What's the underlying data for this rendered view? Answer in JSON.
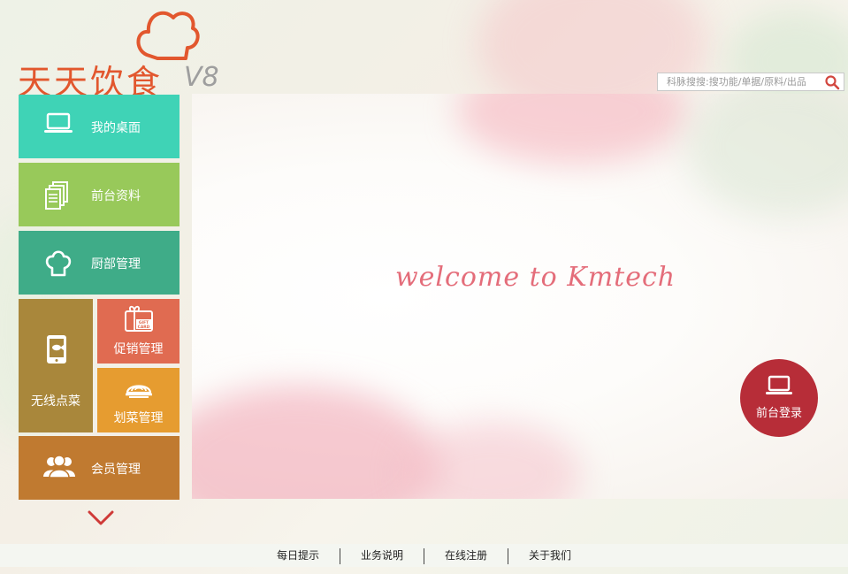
{
  "app": {
    "logo_text": "天天饮食",
    "version": "V8"
  },
  "search": {
    "placeholder": "科脉搜搜:搜功能/单据/原料/出品"
  },
  "main": {
    "welcome": "welcome to Kmtech",
    "login_label": "前台登录"
  },
  "tiles": [
    {
      "label": "我的桌面",
      "icon": "laptop-icon",
      "color": "#3fd3b6"
    },
    {
      "label": "前台资料",
      "icon": "documents-icon",
      "color": "#98c95a"
    },
    {
      "label": "厨部管理",
      "icon": "chef-hat-icon",
      "color": "#3fac88"
    },
    {
      "label": "无线点菜",
      "icon": "tablet-icon",
      "color": "#a9873b"
    },
    {
      "label": "促销管理",
      "icon": "gift-card-icon",
      "color": "#e06b51",
      "icon_text": "GIFT CARD"
    },
    {
      "label": "划菜管理",
      "icon": "dish-icon",
      "color": "#e69c30"
    },
    {
      "label": "会员管理",
      "icon": "members-icon",
      "color": "#c07a30"
    }
  ],
  "footer": {
    "links": [
      "每日提示",
      "业务说明",
      "在线注册",
      "关于我们"
    ]
  },
  "colors": {
    "accent": "#e2572e",
    "login": "#b72d38",
    "welcome": "#e46d7a"
  }
}
